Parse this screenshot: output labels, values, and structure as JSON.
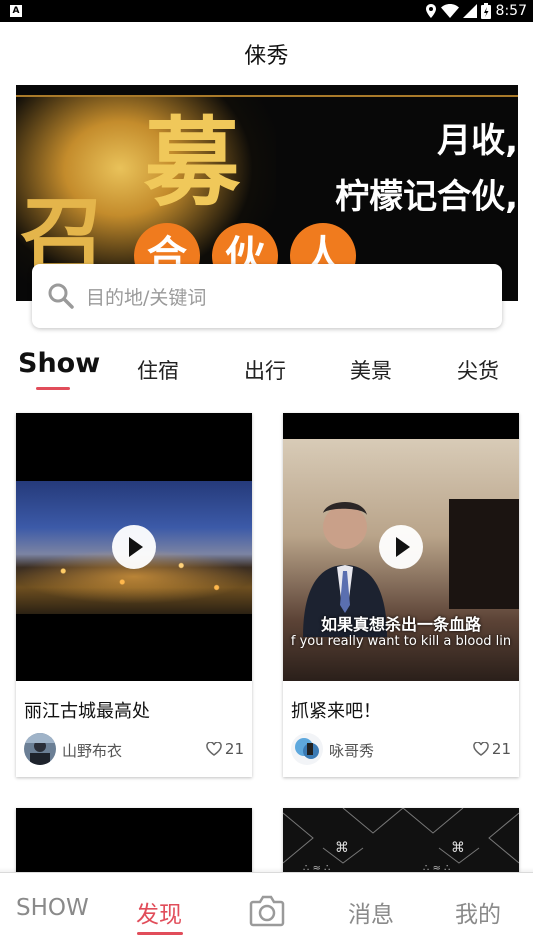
{
  "status_bar": {
    "app_badge": "A",
    "time": "8:57",
    "icons": [
      "location-icon",
      "wifi-icon",
      "signal-icon",
      "battery-icon"
    ]
  },
  "header": {
    "title": "俫秀"
  },
  "banner": {
    "big_char_left": "召",
    "big_char": "募",
    "circle_chars": [
      "合",
      "伙",
      "人"
    ],
    "line1": "月收,",
    "line2": "柠檬记合伙,",
    "accent_color": "#f07b1e"
  },
  "search": {
    "placeholder": "目的地/关键词"
  },
  "tabs": {
    "items": [
      {
        "label": "Show",
        "active": true
      },
      {
        "label": "住宿"
      },
      {
        "label": "出行"
      },
      {
        "label": "美景"
      },
      {
        "label": "尖货"
      }
    ]
  },
  "cards": [
    {
      "title": "丽江古城最高处",
      "author": "山野布衣",
      "likes": "21"
    },
    {
      "title": "抓紧来吧！",
      "author": "咏哥秀",
      "likes": "21",
      "subtitle_cn": "如果真想杀出一条血路",
      "subtitle_en": "f you really want to kill a blood lin"
    }
  ],
  "partial_cards": [
    {
      "pattern": ""
    },
    {
      "pattern": "⌘ ⌘ ⌘ ⌘"
    }
  ],
  "bottom_nav": {
    "items": [
      {
        "label": "SHOW"
      },
      {
        "label": "发现",
        "active": true
      },
      {
        "label": "camera-icon"
      },
      {
        "label": "消息"
      },
      {
        "label": "我的"
      }
    ],
    "active_color": "#e14d5a"
  }
}
